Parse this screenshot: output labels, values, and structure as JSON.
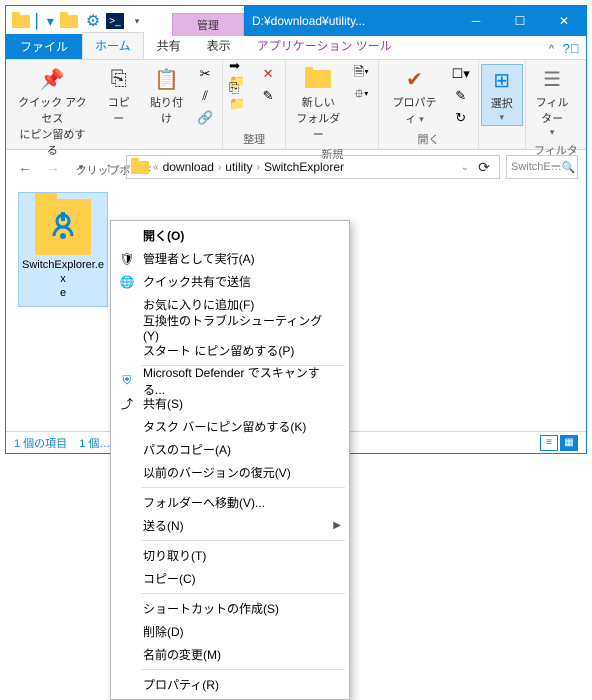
{
  "titlebar": {
    "ctx_tab": "管理",
    "title": "D:¥download¥utility..."
  },
  "tabs": {
    "file": "ファイル",
    "home": "ホーム",
    "share": "共有",
    "view": "表示",
    "apptools": "アプリケーション ツール"
  },
  "ribbon": {
    "quick_pin": "クイック アクセス\nにピン留めする",
    "copy": "コピー",
    "paste": "貼り付け",
    "group_clipboard": "クリップボード",
    "group_organize": "整理",
    "new_folder": "新しい\nフォルダー",
    "group_new": "新規",
    "properties": "プロパティ",
    "group_open": "開く",
    "select": "選択",
    "filter": "フィル\nター",
    "group_filter": "フィルター"
  },
  "breadcrumb": {
    "b1": "download",
    "b2": "utility",
    "b3": "SwitchExplorer"
  },
  "search_placeholder": "SwitchE…",
  "file": {
    "name": "SwitchExplorer.ex\ne"
  },
  "status": {
    "count": "1 個の項目",
    "sel": "1 個…"
  },
  "menu": {
    "open": "開く(O)",
    "runas": "管理者として実行(A)",
    "quickshare": "クイック共有で送信",
    "fav": "お気に入りに追加(F)",
    "compat": "互換性のトラブルシューティング(Y)",
    "pinstart": "スタート にピン留めする(P)",
    "defender": "Microsoft Defender でスキャンする...",
    "share": "共有(S)",
    "pintask": "タスク バーにピン留めする(K)",
    "copypath": "パスのコピー(A)",
    "prevver": "以前のバージョンの復元(V)",
    "moveto": "フォルダーへ移動(V)...",
    "sendto": "送る(N)",
    "cut": "切り取り(T)",
    "copy": "コピー(C)",
    "shortcut": "ショートカットの作成(S)",
    "delete": "削除(D)",
    "rename": "名前の変更(M)",
    "props": "プロパティ(R)"
  }
}
